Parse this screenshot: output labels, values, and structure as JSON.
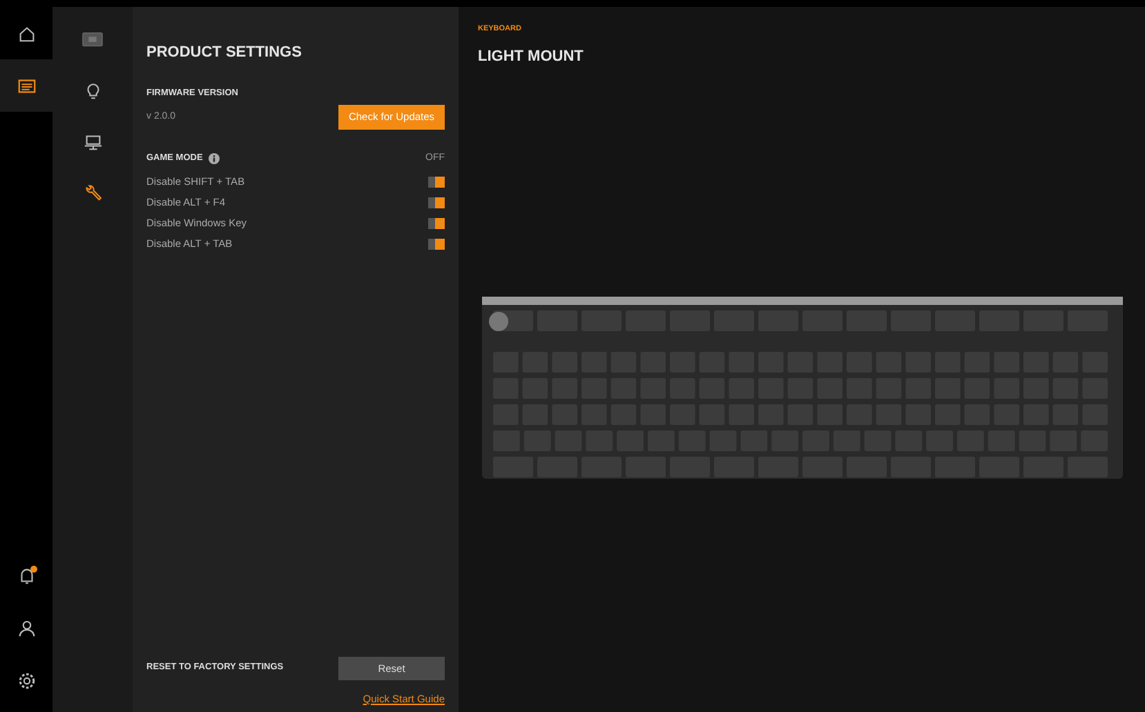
{
  "nav_rail": {
    "items": [
      {
        "kind": "home",
        "selected": false
      },
      {
        "kind": "list",
        "selected": true
      }
    ],
    "bottom_items": [
      {
        "kind": "bell",
        "notification": true
      },
      {
        "kind": "user"
      },
      {
        "kind": "gear"
      }
    ]
  },
  "device_rail": {
    "items": [
      {
        "kind": "device",
        "selected": false
      },
      {
        "kind": "bulb",
        "selected": false
      },
      {
        "kind": "lamp",
        "selected": false
      },
      {
        "kind": "wrench",
        "selected": true
      }
    ]
  },
  "settings": {
    "title": "PRODUCT SETTINGS",
    "firmware_label": "FIRMWARE VERSION",
    "firmware_version": "v 2.0.0",
    "update_button": "Check for Updates",
    "game_mode": {
      "label": "GAME MODE",
      "status": "OFF",
      "toggles": [
        {
          "label": "Disable SHIFT + TAB",
          "on": true
        },
        {
          "label": "Disable ALT + F4",
          "on": true
        },
        {
          "label": "Disable Windows Key",
          "on": true
        },
        {
          "label": "Disable ALT + TAB",
          "on": true
        }
      ]
    },
    "reset_label": "RESET TO FACTORY SETTINGS",
    "reset_button": "Reset",
    "guide_link": "Quick Start Guide"
  },
  "device": {
    "category": "KEYBOARD",
    "name": "LIGHT MOUNT"
  }
}
